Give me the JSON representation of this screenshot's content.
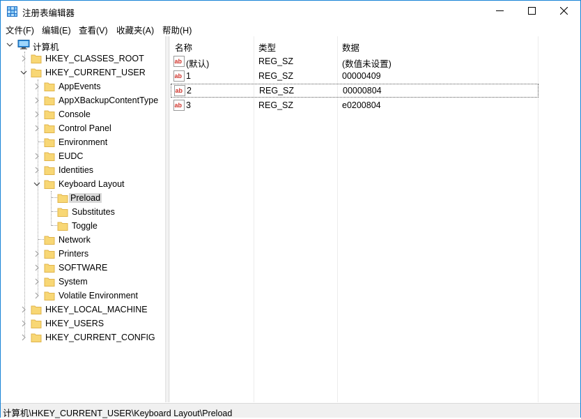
{
  "window": {
    "title": "注册表编辑器"
  },
  "menu": [
    {
      "label": "文件(F)"
    },
    {
      "label": "编辑(E)"
    },
    {
      "label": "查看(V)"
    },
    {
      "label": "收藏夹(A)"
    },
    {
      "label": "帮助(H)"
    }
  ],
  "tree": {
    "root": "计算机",
    "hkey_classes_root": "HKEY_CLASSES_ROOT",
    "hkey_current_user": "HKEY_CURRENT_USER",
    "hkcu_children": [
      "AppEvents",
      "AppXBackupContentType",
      "Console",
      "Control Panel",
      "Environment",
      "EUDC",
      "Identities",
      "Keyboard Layout",
      "Network",
      "Printers",
      "SOFTWARE",
      "System",
      "Volatile Environment"
    ],
    "keyboard_layout_children": [
      "Preload",
      "Substitutes",
      "Toggle"
    ],
    "hkey_local_machine": "HKEY_LOCAL_MACHINE",
    "hkey_users": "HKEY_USERS",
    "hkey_current_config": "HKEY_CURRENT_CONFIG"
  },
  "list": {
    "columns": {
      "name": "名称",
      "type": "类型",
      "data": "数据"
    },
    "rows": [
      {
        "name": "(默认)",
        "type": "REG_SZ",
        "data": "(数值未设置)"
      },
      {
        "name": "1",
        "type": "REG_SZ",
        "data": "00000409"
      },
      {
        "name": "2",
        "type": "REG_SZ",
        "data": "00000804"
      },
      {
        "name": "3",
        "type": "REG_SZ",
        "data": "e0200804"
      }
    ]
  },
  "status": {
    "path": "计算机\\HKEY_CURRENT_USER\\Keyboard Layout\\Preload"
  },
  "colors": {
    "accent": "#1883d7",
    "folder": "#f8d775",
    "folder_dark": "#e0b44c",
    "selection": "#d9d9d9"
  },
  "icons": {
    "app": "regedit-icon",
    "computer": "computer-icon",
    "folder": "folder-icon",
    "string_value": "reg-sz-icon",
    "minimize": "minimize-icon",
    "maximize": "maximize-icon",
    "close": "close-icon"
  }
}
